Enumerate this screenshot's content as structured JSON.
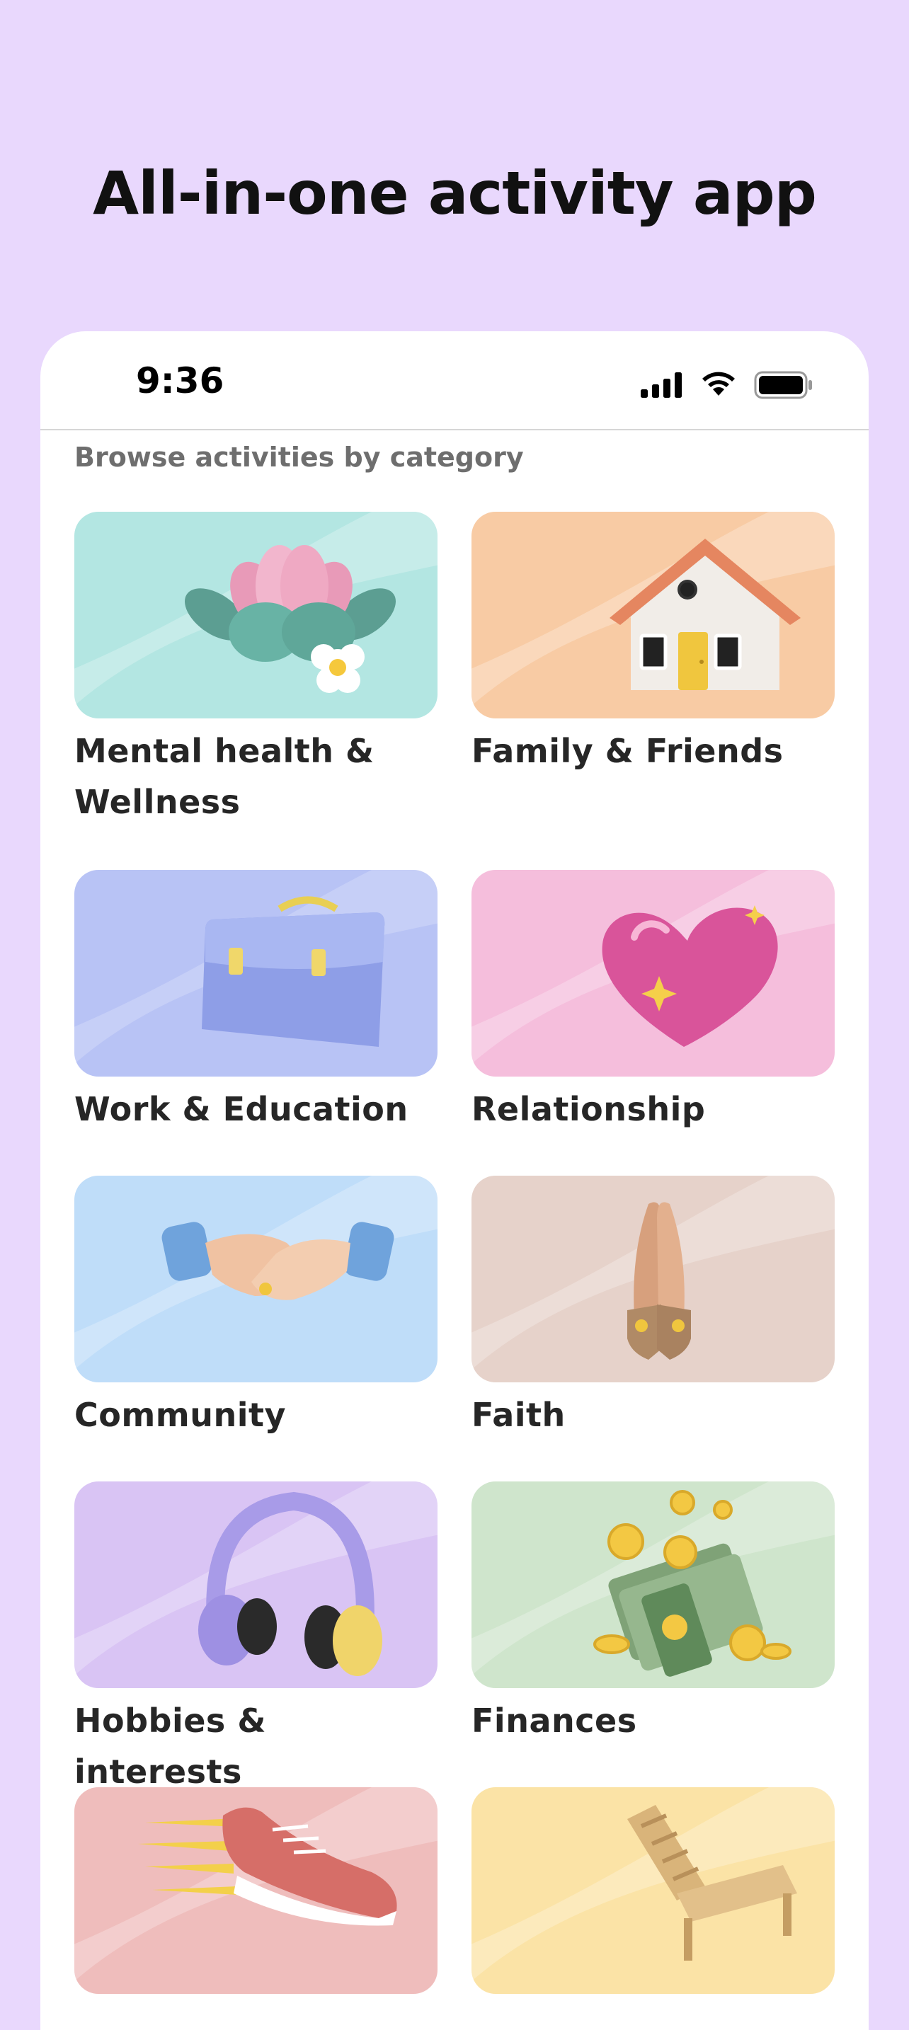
{
  "headline": "All-in-one activity app",
  "status_bar": {
    "time": "9:36",
    "icons": [
      "cellular-signal-icon",
      "wifi-icon",
      "battery-icon"
    ]
  },
  "section_title": "Browse activities by category",
  "categories": [
    {
      "label": "Mental health & Wellness",
      "icon": "lotus-icon",
      "color": "#B3E6E2"
    },
    {
      "label": "Family & Friends",
      "icon": "house-icon",
      "color": "#F8CBA4"
    },
    {
      "label": "Work & Education",
      "icon": "briefcase-icon",
      "color": "#B8C3F5"
    },
    {
      "label": "Relationship",
      "icon": "heart-icon",
      "color": "#F5BEDC"
    },
    {
      "label": "Community",
      "icon": "handshake-icon",
      "color": "#BFDDF9"
    },
    {
      "label": "Faith",
      "icon": "praying-hands-icon",
      "color": "#E6D2CA"
    },
    {
      "label": "Hobbies & interests",
      "icon": "headphones-icon",
      "color": "#D9C4F4"
    },
    {
      "label": "Finances",
      "icon": "money-coins-icon",
      "color": "#CFE5CC"
    },
    {
      "label": "",
      "icon": "sneaker-icon",
      "color": "#EFBDBC"
    },
    {
      "label": "",
      "icon": "lounge-chair-icon",
      "color": "#FBE3A6"
    }
  ]
}
